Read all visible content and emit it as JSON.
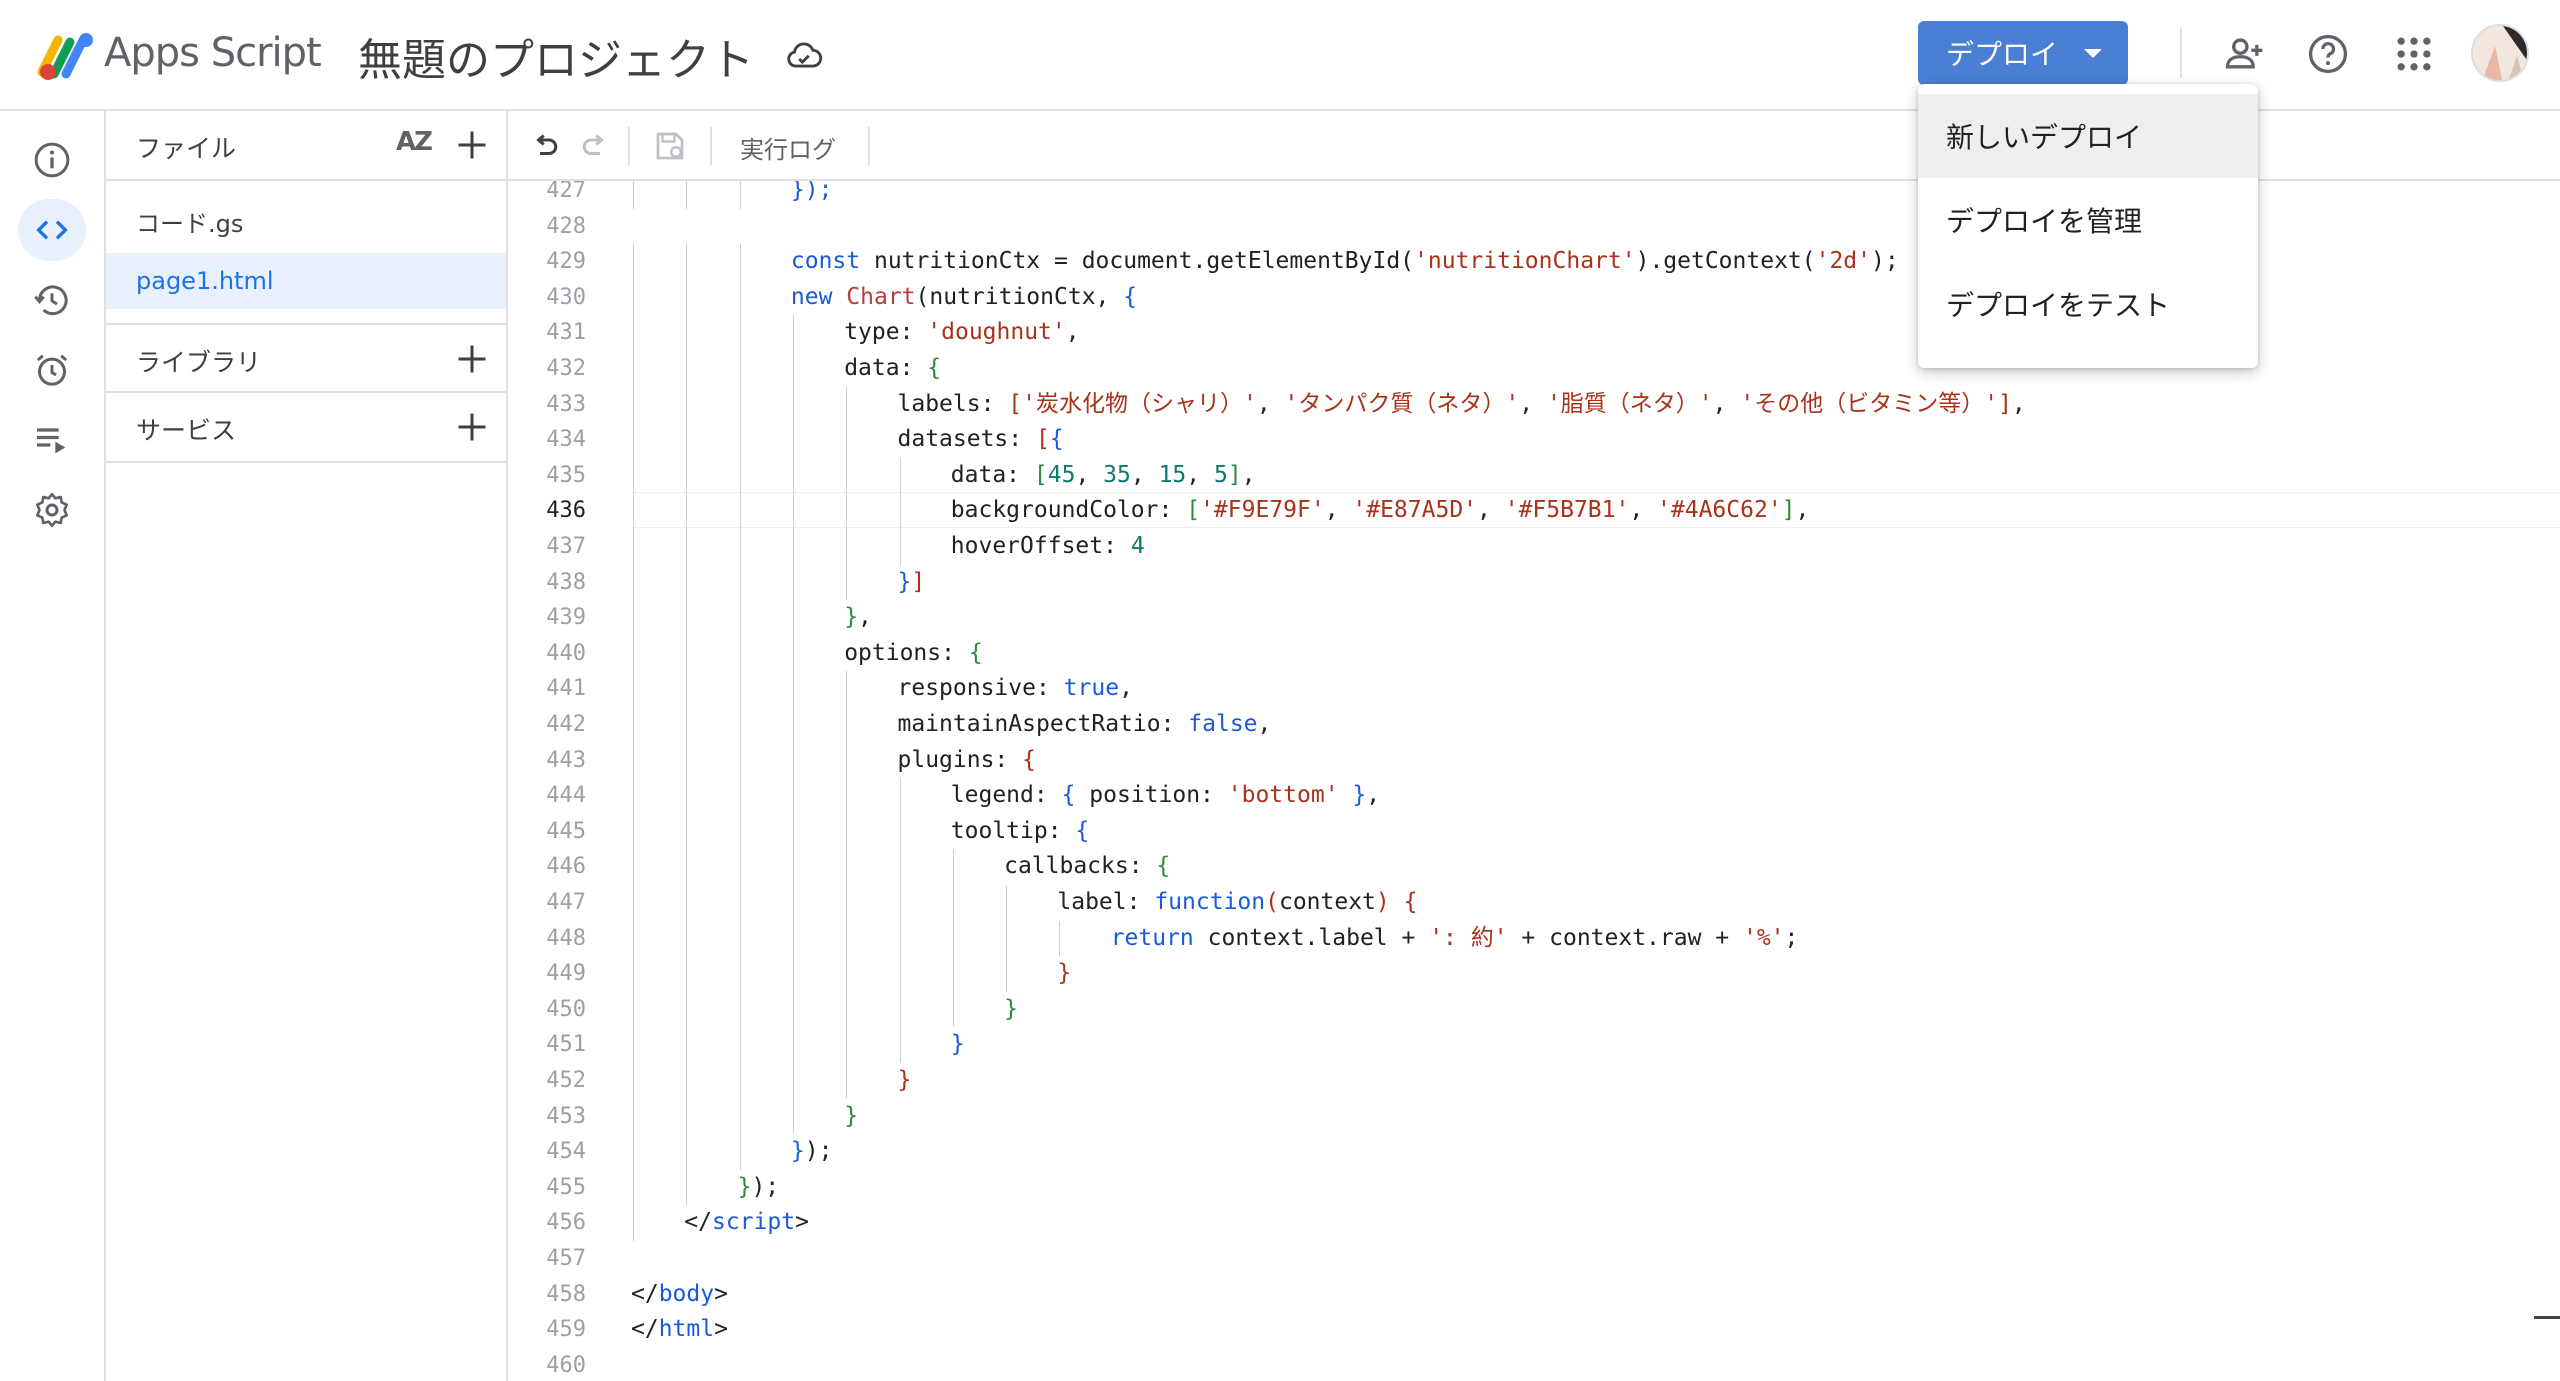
{
  "header": {
    "app_name": "Apps Script",
    "project_title": "無題のプロジェクト",
    "deploy_label": "デプロイ"
  },
  "deploy_menu": {
    "items": [
      {
        "label": "新しいデプロイ"
      },
      {
        "label": "デプロイを管理"
      },
      {
        "label": "デプロイをテスト"
      }
    ]
  },
  "files_panel": {
    "files_label": "ファイル",
    "sort_label": "AZ",
    "files": [
      {
        "name": "コード.gs"
      },
      {
        "name": "page1.html"
      }
    ],
    "libraries_label": "ライブラリ",
    "services_label": "サービス"
  },
  "toolbar": {
    "log_label": "実行ログ"
  },
  "editor": {
    "active_line": 436,
    "lines": [
      {
        "n": "427",
        "indent": 3,
        "tokens": [
          {
            "t": "});",
            "c": "br1"
          }
        ]
      },
      {
        "n": "428",
        "indent": 0,
        "tokens": []
      },
      {
        "n": "429",
        "indent": 3,
        "tokens": [
          {
            "t": "const ",
            "c": "kw"
          },
          {
            "t": "nutritionCtx = document.getElementById(",
            "c": "pun"
          },
          {
            "t": "'nutritionChart'",
            "c": "str"
          },
          {
            "t": ").getContext(",
            "c": "pun"
          },
          {
            "t": "'2d'",
            "c": "str"
          },
          {
            "t": ");",
            "c": "pun"
          }
        ]
      },
      {
        "n": "430",
        "indent": 3,
        "tokens": [
          {
            "t": "new ",
            "c": "kw"
          },
          {
            "t": "Chart",
            "c": "fn"
          },
          {
            "t": "(nutritionCtx, ",
            "c": "pun"
          },
          {
            "t": "{",
            "c": "br1"
          }
        ]
      },
      {
        "n": "431",
        "indent": 4,
        "tokens": [
          {
            "t": "type: ",
            "c": "pun"
          },
          {
            "t": "'doughnut'",
            "c": "str"
          },
          {
            "t": ",",
            "c": "pun"
          }
        ]
      },
      {
        "n": "432",
        "indent": 4,
        "tokens": [
          {
            "t": "data: ",
            "c": "pun"
          },
          {
            "t": "{",
            "c": "br2"
          }
        ]
      },
      {
        "n": "433",
        "indent": 5,
        "tokens": [
          {
            "t": "labels: ",
            "c": "pun"
          },
          {
            "t": "[",
            "c": "br3"
          },
          {
            "t": "'炭水化物（シャリ）'",
            "c": "str"
          },
          {
            "t": ", ",
            "c": "pun"
          },
          {
            "t": "'タンパク質（ネタ）'",
            "c": "str"
          },
          {
            "t": ", ",
            "c": "pun"
          },
          {
            "t": "'脂質（ネタ）'",
            "c": "str"
          },
          {
            "t": ", ",
            "c": "pun"
          },
          {
            "t": "'その他（ビタミン等）'",
            "c": "str"
          },
          {
            "t": "]",
            "c": "br3"
          },
          {
            "t": ",",
            "c": "pun"
          }
        ]
      },
      {
        "n": "434",
        "indent": 5,
        "tokens": [
          {
            "t": "datasets: ",
            "c": "pun"
          },
          {
            "t": "[",
            "c": "br3"
          },
          {
            "t": "{",
            "c": "br1"
          }
        ]
      },
      {
        "n": "435",
        "indent": 6,
        "tokens": [
          {
            "t": "data: ",
            "c": "pun"
          },
          {
            "t": "[",
            "c": "br2"
          },
          {
            "t": "45",
            "c": "num"
          },
          {
            "t": ", ",
            "c": "pun"
          },
          {
            "t": "35",
            "c": "num"
          },
          {
            "t": ", ",
            "c": "pun"
          },
          {
            "t": "15",
            "c": "num"
          },
          {
            "t": ", ",
            "c": "pun"
          },
          {
            "t": "5",
            "c": "num"
          },
          {
            "t": "]",
            "c": "br2"
          },
          {
            "t": ",",
            "c": "pun"
          }
        ]
      },
      {
        "n": "436",
        "indent": 6,
        "tokens": [
          {
            "t": "backgroundColor: ",
            "c": "pun"
          },
          {
            "t": "[",
            "c": "br2"
          },
          {
            "t": "'#F9E79F'",
            "c": "str"
          },
          {
            "t": ", ",
            "c": "pun"
          },
          {
            "t": "'#E87A5D'",
            "c": "str"
          },
          {
            "t": ", ",
            "c": "pun"
          },
          {
            "t": "'#F5B7B1'",
            "c": "str"
          },
          {
            "t": ", ",
            "c": "pun"
          },
          {
            "t": "'#4A6C62'",
            "c": "str"
          },
          {
            "t": "]",
            "c": "br2"
          },
          {
            "t": ",",
            "c": "pun"
          }
        ]
      },
      {
        "n": "437",
        "indent": 6,
        "tokens": [
          {
            "t": "hoverOffset: ",
            "c": "pun"
          },
          {
            "t": "4",
            "c": "num"
          }
        ]
      },
      {
        "n": "438",
        "indent": 5,
        "tokens": [
          {
            "t": "}",
            "c": "br1"
          },
          {
            "t": "]",
            "c": "br3"
          }
        ]
      },
      {
        "n": "439",
        "indent": 4,
        "tokens": [
          {
            "t": "}",
            "c": "br2"
          },
          {
            "t": ",",
            "c": "pun"
          }
        ]
      },
      {
        "n": "440",
        "indent": 4,
        "tokens": [
          {
            "t": "options: ",
            "c": "pun"
          },
          {
            "t": "{",
            "c": "br2"
          }
        ]
      },
      {
        "n": "441",
        "indent": 5,
        "tokens": [
          {
            "t": "responsive: ",
            "c": "pun"
          },
          {
            "t": "true",
            "c": "kw"
          },
          {
            "t": ",",
            "c": "pun"
          }
        ]
      },
      {
        "n": "442",
        "indent": 5,
        "tokens": [
          {
            "t": "maintainAspectRatio: ",
            "c": "pun"
          },
          {
            "t": "false",
            "c": "kw"
          },
          {
            "t": ",",
            "c": "pun"
          }
        ]
      },
      {
        "n": "443",
        "indent": 5,
        "tokens": [
          {
            "t": "plugins: ",
            "c": "pun"
          },
          {
            "t": "{",
            "c": "br3"
          }
        ]
      },
      {
        "n": "444",
        "indent": 6,
        "tokens": [
          {
            "t": "legend: ",
            "c": "pun"
          },
          {
            "t": "{",
            "c": "br1"
          },
          {
            "t": " position: ",
            "c": "pun"
          },
          {
            "t": "'bottom'",
            "c": "str"
          },
          {
            "t": " }",
            "c": "br1"
          },
          {
            "t": ",",
            "c": "pun"
          }
        ]
      },
      {
        "n": "445",
        "indent": 6,
        "tokens": [
          {
            "t": "tooltip: ",
            "c": "pun"
          },
          {
            "t": "{",
            "c": "br1"
          }
        ]
      },
      {
        "n": "446",
        "indent": 7,
        "tokens": [
          {
            "t": "callbacks: ",
            "c": "pun"
          },
          {
            "t": "{",
            "c": "br2"
          }
        ]
      },
      {
        "n": "447",
        "indent": 8,
        "tokens": [
          {
            "t": "label: ",
            "c": "pun"
          },
          {
            "t": "function",
            "c": "kw"
          },
          {
            "t": "(",
            "c": "br3"
          },
          {
            "t": "context",
            "c": "pun"
          },
          {
            "t": ")",
            "c": "br3"
          },
          {
            "t": " ",
            "c": "pun"
          },
          {
            "t": "{",
            "c": "br3"
          }
        ]
      },
      {
        "n": "448",
        "indent": 9,
        "tokens": [
          {
            "t": "return ",
            "c": "kw"
          },
          {
            "t": "context.label + ",
            "c": "pun"
          },
          {
            "t": "': 約'",
            "c": "str"
          },
          {
            "t": " + context.raw + ",
            "c": "pun"
          },
          {
            "t": "'%'",
            "c": "str"
          },
          {
            "t": ";",
            "c": "pun"
          }
        ]
      },
      {
        "n": "449",
        "indent": 8,
        "tokens": [
          {
            "t": "}",
            "c": "br3"
          }
        ]
      },
      {
        "n": "450",
        "indent": 7,
        "tokens": [
          {
            "t": "}",
            "c": "br2"
          }
        ]
      },
      {
        "n": "451",
        "indent": 6,
        "tokens": [
          {
            "t": "}",
            "c": "br1"
          }
        ]
      },
      {
        "n": "452",
        "indent": 5,
        "tokens": [
          {
            "t": "}",
            "c": "br3"
          }
        ]
      },
      {
        "n": "453",
        "indent": 4,
        "tokens": [
          {
            "t": "}",
            "c": "br2"
          }
        ]
      },
      {
        "n": "454",
        "indent": 3,
        "tokens": [
          {
            "t": "}",
            "c": "br1"
          },
          {
            "t": ");",
            "c": "pun"
          }
        ]
      },
      {
        "n": "455",
        "indent": 2,
        "tokens": [
          {
            "t": "}",
            "c": "br2"
          },
          {
            "t": ");",
            "c": "pun"
          }
        ]
      },
      {
        "n": "456",
        "indent": 1,
        "tokens": [
          {
            "t": "</",
            "c": "pun"
          },
          {
            "t": "script",
            "c": "tag"
          },
          {
            "t": ">",
            "c": "pun"
          }
        ]
      },
      {
        "n": "457",
        "indent": 0,
        "tokens": []
      },
      {
        "n": "458",
        "indent": 0,
        "tokens": [
          {
            "t": "</",
            "c": "pun"
          },
          {
            "t": "body",
            "c": "tag"
          },
          {
            "t": ">",
            "c": "pun"
          }
        ]
      },
      {
        "n": "459",
        "indent": 0,
        "tokens": [
          {
            "t": "</",
            "c": "pun"
          },
          {
            "t": "html",
            "c": "tag"
          },
          {
            "t": ">",
            "c": "pun"
          }
        ]
      },
      {
        "n": "460",
        "indent": 0,
        "tokens": []
      }
    ]
  },
  "icons": {
    "cloud": "cloud-icon",
    "add_person": "person-add-icon",
    "help": "help-icon",
    "apps": "apps-grid-icon",
    "rail": [
      "info-icon",
      "code-icon",
      "history-icon",
      "alarm-icon",
      "execution-list-icon",
      "gear-icon"
    ]
  }
}
